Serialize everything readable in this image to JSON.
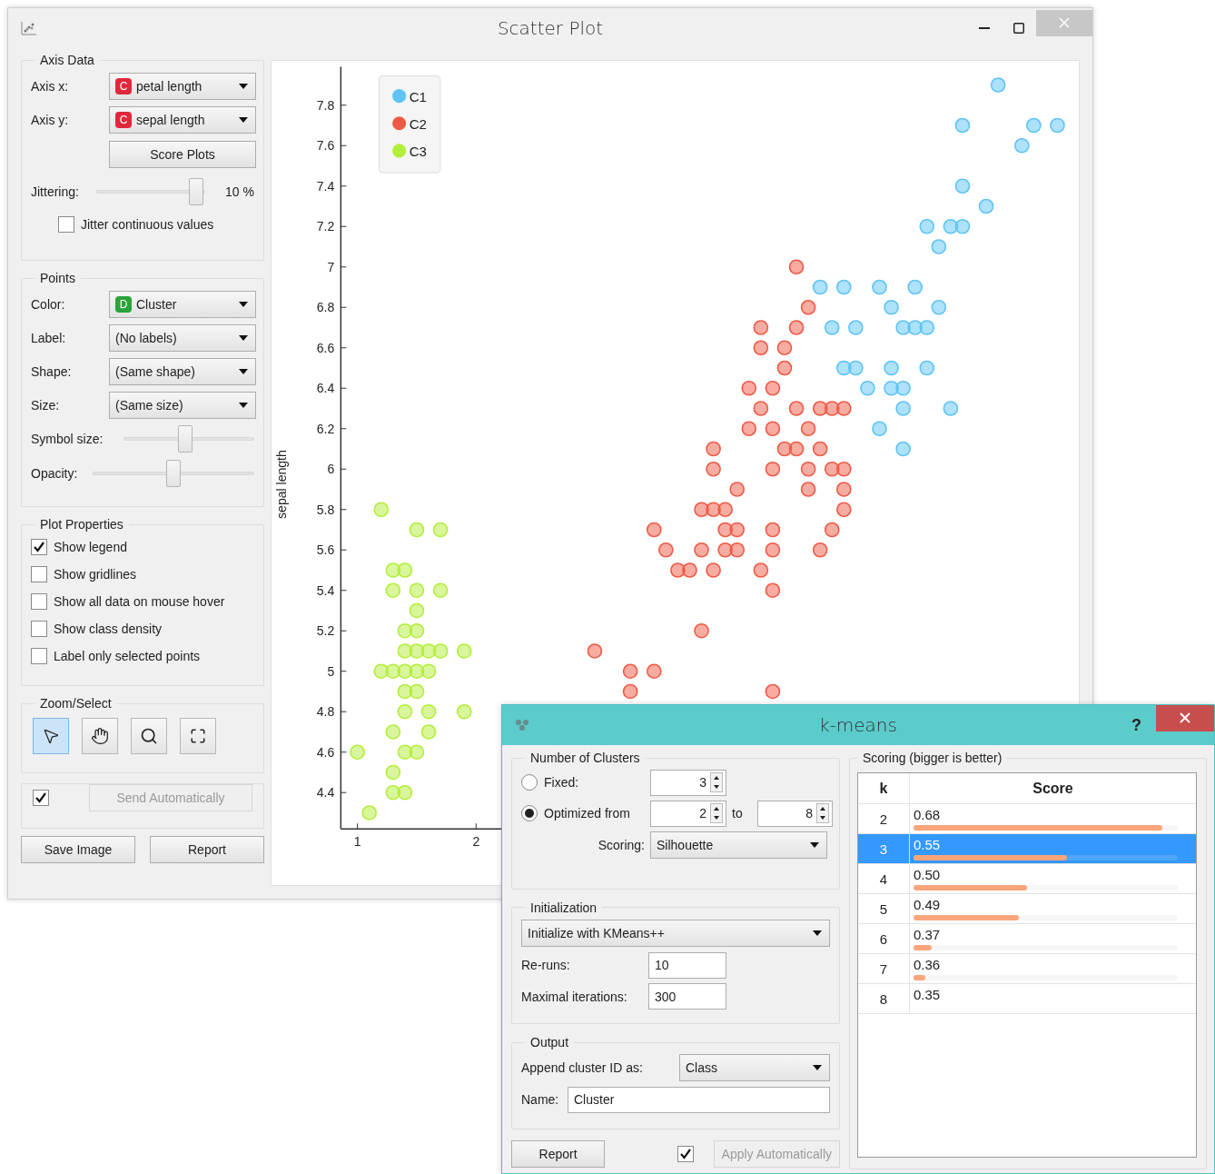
{
  "scatter_window": {
    "title": "Scatter Plot",
    "axis_data": {
      "title": "Axis Data",
      "axes": [
        {
          "label": "Axis x:",
          "value": "petal length",
          "badge": {
            "text": "C",
            "color": "#e0283c"
          }
        },
        {
          "label": "Axis y:",
          "value": "sepal length",
          "badge": {
            "text": "C",
            "color": "#e0283c"
          }
        }
      ],
      "score_button": "Score Plots",
      "jittering": {
        "label": "Jittering:",
        "level": 0.92,
        "reading": "10 %"
      },
      "jitter_continuous": {
        "label": "Jitter continuous values",
        "checked": false
      }
    },
    "points": {
      "title": "Points",
      "combos": [
        {
          "label": "Color:",
          "value": "Cluster",
          "badge": {
            "text": "D",
            "color": "#2aa43a"
          }
        },
        {
          "label": "Label:",
          "value": "(No labels)"
        },
        {
          "label": "Shape:",
          "value": "(Same shape)"
        },
        {
          "label": "Size:",
          "value": "(Same size)"
        }
      ],
      "sliders": [
        {
          "label": "Symbol size:",
          "level": 0.47
        },
        {
          "label": "Opacity:",
          "level": 0.5
        }
      ]
    },
    "plot_properties": {
      "title": "Plot Properties",
      "options": [
        {
          "label": "Show legend",
          "checked": true
        },
        {
          "label": "Show gridlines",
          "checked": false
        },
        {
          "label": "Show all data on mouse hover",
          "checked": false
        },
        {
          "label": "Show class density",
          "checked": false
        },
        {
          "label": "Label only selected points",
          "checked": false
        }
      ]
    },
    "zoom_select": {
      "title": "Zoom/Select",
      "tools": [
        {
          "kind": "pointer",
          "selected": true
        },
        {
          "kind": "hand",
          "selected": false
        },
        {
          "kind": "zoom",
          "selected": false
        },
        {
          "kind": "fit",
          "selected": false
        }
      ]
    },
    "send_automatically": {
      "checked": true,
      "label": "Send Automatically",
      "disabled": true
    },
    "buttons": [
      "Save Image",
      "Report"
    ],
    "plot": {
      "chart_data": {
        "type": "scatter",
        "ylabel": "sepal length",
        "legend": true,
        "xlim": [
          0.86,
          7.08
        ],
        "ylim": [
          4.22,
          7.99
        ],
        "xticks": [
          1,
          2
        ],
        "yticks": [
          4.4,
          4.6,
          4.8,
          5,
          5.2,
          5.4,
          5.6,
          5.8,
          6,
          6.2,
          6.4,
          6.6,
          6.8,
          7,
          7.2,
          7.4,
          7.6,
          7.8
        ],
        "series": [
          {
            "name": "C1",
            "color": "#5ec4f5",
            "x": [
              6.4,
              6.1,
              6.7,
              6.9,
              6.6,
              6.1,
              6.3,
              5.8,
              6.0,
              6.1,
              5.9,
              4.9,
              5.1,
              5.4,
              5.7,
              5.5,
              5.9,
              5.0,
              5.2,
              5.6,
              5.7,
              5.8,
              5.1,
              5.2,
              5.5,
              5.8,
              5.3,
              5.5,
              5.6,
              5.6,
              6.0,
              5.4,
              5.6
            ],
            "values": [
              7.9,
              7.7,
              7.7,
              7.7,
              7.6,
              7.4,
              7.3,
              7.2,
              7.2,
              7.2,
              7.1,
              6.9,
              6.9,
              6.9,
              6.9,
              6.8,
              6.8,
              6.7,
              6.7,
              6.7,
              6.7,
              6.7,
              6.5,
              6.5,
              6.5,
              6.5,
              6.4,
              6.4,
              6.4,
              6.3,
              6.3,
              6.2,
              6.1
            ]
          },
          {
            "name": "C2",
            "color": "#ef5a45",
            "x": [
              4.7,
              4.8,
              4.4,
              4.7,
              4.4,
              4.6,
              4.6,
              4.3,
              4.5,
              4.4,
              4.7,
              4.9,
              5.0,
              5.1,
              4.3,
              4.5,
              4.8,
              4.0,
              4.6,
              4.7,
              4.9,
              4.0,
              4.5,
              4.8,
              5.0,
              5.1,
              4.2,
              4.8,
              5.1,
              3.9,
              4.0,
              4.1,
              5.1,
              3.5,
              4.1,
              4.2,
              4.5,
              5.0,
              3.6,
              3.9,
              4.1,
              4.2,
              4.5,
              4.9,
              3.7,
              3.8,
              4.0,
              4.4,
              4.5,
              3.9,
              3.0,
              3.3,
              3.5,
              3.3,
              4.5
            ],
            "values": [
              7.0,
              6.8,
              6.7,
              6.7,
              6.6,
              6.6,
              6.5,
              6.4,
              6.4,
              6.3,
              6.3,
              6.3,
              6.3,
              6.3,
              6.2,
              6.2,
              6.2,
              6.1,
              6.1,
              6.1,
              6.1,
              6.0,
              6.0,
              6.0,
              6.0,
              6.0,
              5.9,
              5.9,
              5.9,
              5.8,
              5.8,
              5.8,
              5.8,
              5.7,
              5.7,
              5.7,
              5.7,
              5.7,
              5.6,
              5.6,
              5.6,
              5.6,
              5.6,
              5.6,
              5.5,
              5.5,
              5.5,
              5.5,
              5.4,
              5.2,
              5.1,
              5.0,
              5.0,
              4.9,
              4.9
            ]
          },
          {
            "name": "C3",
            "color": "#b3ee3a",
            "x": [
              1.2,
              1.5,
              1.7,
              1.3,
              1.4,
              1.3,
              1.5,
              1.7,
              1.5,
              1.4,
              1.5,
              1.4,
              1.5,
              1.6,
              1.7,
              1.9,
              1.2,
              1.3,
              1.4,
              1.5,
              1.6,
              1.4,
              1.5,
              1.4,
              1.6,
              1.9,
              1.3,
              1.6,
              1.0,
              1.4,
              1.5,
              1.3,
              1.3,
              1.4,
              1.1
            ],
            "values": [
              5.8,
              5.7,
              5.7,
              5.5,
              5.5,
              5.4,
              5.4,
              5.4,
              5.3,
              5.2,
              5.2,
              5.1,
              5.1,
              5.1,
              5.1,
              5.1,
              5.0,
              5.0,
              5.0,
              5.0,
              5.0,
              4.9,
              4.9,
              4.8,
              4.8,
              4.8,
              4.7,
              4.7,
              4.6,
              4.6,
              4.6,
              4.5,
              4.4,
              4.4,
              4.3
            ]
          }
        ]
      }
    }
  },
  "kmeans_window": {
    "title": "k-means",
    "help": "?",
    "number_of_clusters": {
      "title": "Number of Clusters",
      "fixed": {
        "label": "Fixed:",
        "value": "3",
        "selected": false
      },
      "optimized": {
        "label": "Optimized from",
        "from": "2",
        "to_label": "to",
        "to": "8",
        "selected": true
      },
      "scoring": {
        "label": "Scoring:",
        "value": "Silhouette"
      }
    },
    "initialization": {
      "title": "Initialization",
      "method": "Initialize with KMeans++",
      "reruns": {
        "label": "Re-runs:",
        "value": "10"
      },
      "max_iterations": {
        "label": "Maximal iterations:",
        "value": "300"
      }
    },
    "output": {
      "title": "Output",
      "append": {
        "label": "Append cluster ID as:",
        "value": "Class"
      },
      "name": {
        "label": "Name:",
        "value": "Cluster"
      }
    },
    "report_button": "Report",
    "apply_automatically": {
      "checked": true,
      "label": "Apply Automatically",
      "disabled": true
    },
    "scoring_table": {
      "title": "Scoring (bigger is better)",
      "columns": [
        "k",
        "Score"
      ],
      "rows": [
        {
          "k": "2",
          "score": "0.68",
          "level": 0.94,
          "selected": false
        },
        {
          "k": "3",
          "score": "0.55",
          "level": 0.58,
          "selected": true
        },
        {
          "k": "4",
          "score": "0.50",
          "level": 0.43,
          "selected": false
        },
        {
          "k": "5",
          "score": "0.49",
          "level": 0.4,
          "selected": false
        },
        {
          "k": "6",
          "score": "0.37",
          "level": 0.07,
          "selected": false
        },
        {
          "k": "7",
          "score": "0.36",
          "level": 0.045,
          "selected": false
        },
        {
          "k": "8",
          "score": "0.35",
          "selected": false
        }
      ]
    }
  }
}
